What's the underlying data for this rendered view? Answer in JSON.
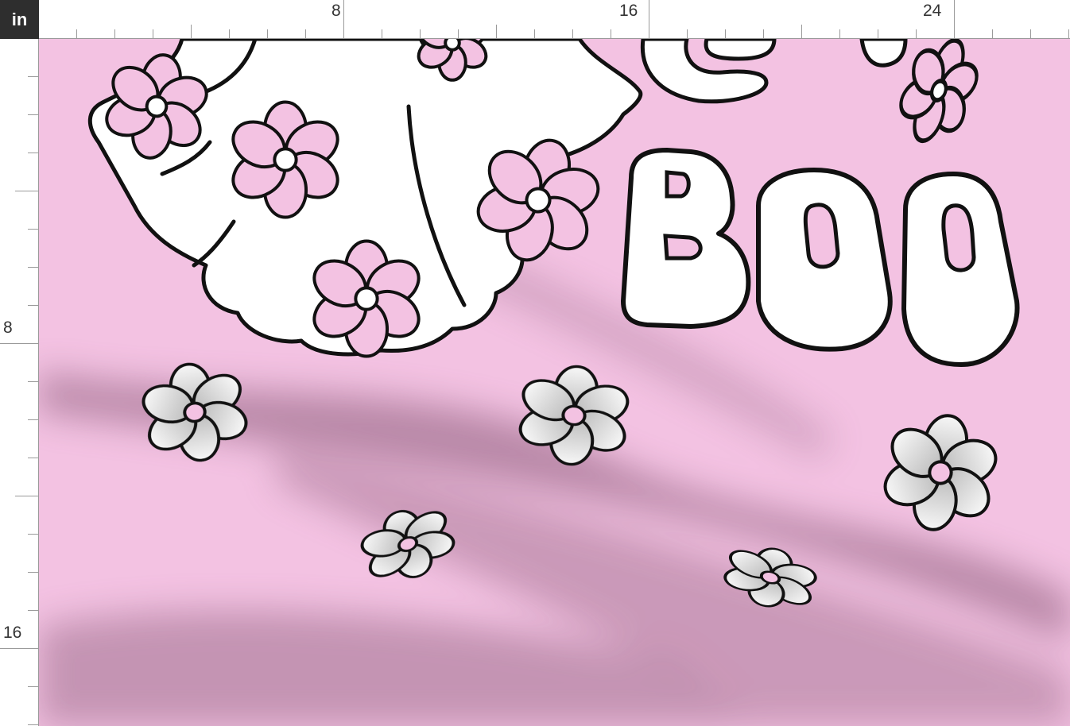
{
  "ruler": {
    "unit": "in",
    "top_labels": [
      "8",
      "16",
      "24"
    ],
    "left_labels": [
      "8",
      "16"
    ]
  },
  "artwork": {
    "text": "BOO",
    "colors": {
      "background": "#f3c2e2",
      "flower_pink": "#f3c2e2",
      "outline": "#111111",
      "ghost_white": "#ffffff",
      "daisy_gray": "#c8c8c8"
    },
    "icons": [
      "ghost-icon",
      "flower-icon",
      "daisy-icon"
    ]
  }
}
